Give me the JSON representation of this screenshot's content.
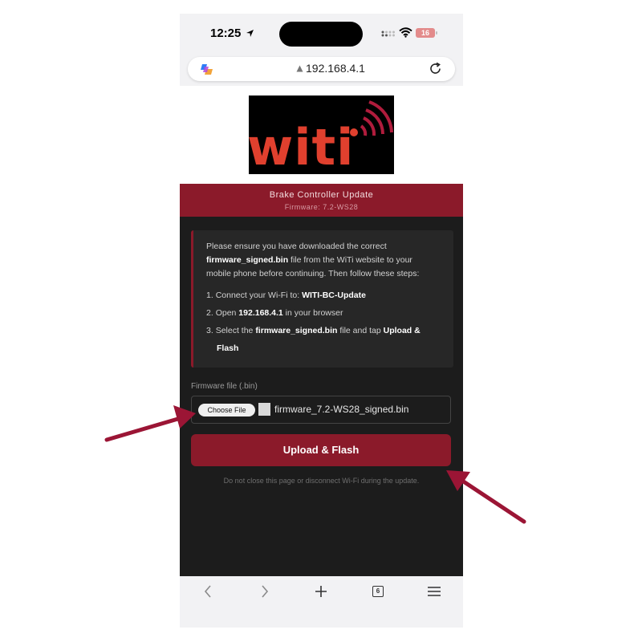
{
  "status_bar": {
    "time": "12:25",
    "battery": "16"
  },
  "url_bar": {
    "url": "192.168.4.1"
  },
  "logo": {
    "text": "witi"
  },
  "header": {
    "title": "Brake Controller Update",
    "subtitle": "Firmware: 7.2-WS28"
  },
  "info": {
    "line1_a": "Please ensure you have downloaded the correct",
    "line2_bold": "firmware_signed.bin",
    "line2_b": " file from the WiTi website to your",
    "line3": "mobile phone before continuing. Then follow these steps:",
    "steps": [
      {
        "num": "1.",
        "text": "Connect your Wi-Fi to: ",
        "bold": "WITI-BC-Update",
        "tail": ""
      },
      {
        "num": "2.",
        "text": "Open ",
        "bold": "192.168.4.1",
        "tail": " in your browser"
      },
      {
        "num": "3.",
        "text": "Select the ",
        "bold": "firmware_signed.bin",
        "tail": " file and tap ",
        "bold2": "Upload &",
        "line2": "Flash"
      }
    ]
  },
  "form": {
    "file_label": "Firmware file (.bin)",
    "choose_button": "Choose File",
    "file_name": "firmware_7.2-WS28_signed.bin",
    "upload_button": "Upload & Flash",
    "warning": "Do not close this page or disconnect Wi-Fi during the update."
  },
  "toolbar": {
    "tab_count": "6"
  },
  "colors": {
    "brand_red": "#8b1a2a",
    "arrow": "#9b1535",
    "logo_text": "#e0402e",
    "dark_bg": "#1c1c1c"
  }
}
